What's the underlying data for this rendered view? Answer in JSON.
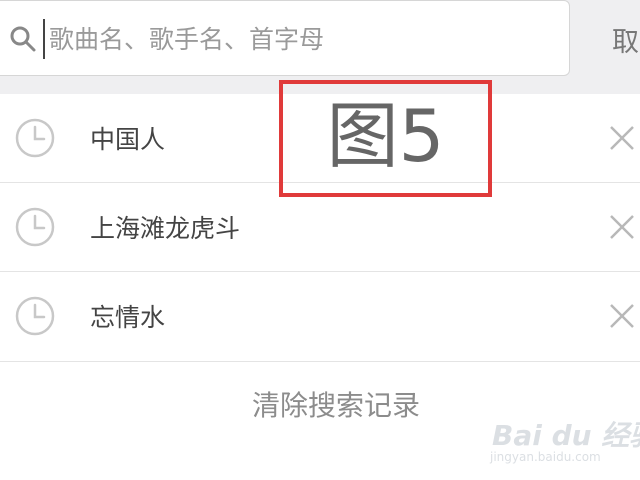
{
  "search": {
    "placeholder": "歌曲名、歌手名、首字母",
    "cancel_label": "取消"
  },
  "history": {
    "items": [
      {
        "label": "中国人"
      },
      {
        "label": "上海滩龙虎斗"
      },
      {
        "label": "忘情水"
      }
    ],
    "clear_label": "清除搜索记录"
  },
  "annotation": {
    "label": "图5",
    "color": "#e03a3a"
  },
  "watermark": {
    "logo_text": "Bai du 经验",
    "url": "jingyan.baidu.com"
  },
  "colors": {
    "top_bar_bg": "#efeff1",
    "icon_gray": "#c8c8c8",
    "text_dark": "#444444",
    "text_light": "#8c8c8c"
  }
}
